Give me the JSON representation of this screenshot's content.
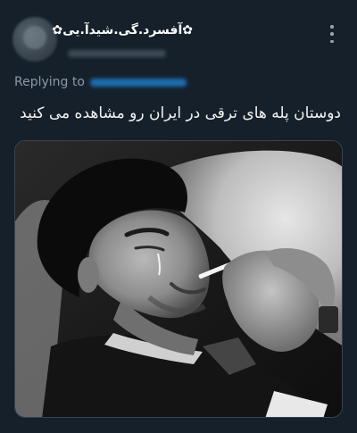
{
  "author": {
    "display_name": "✿آفسرد.گی.شیدآ.یی✿"
  },
  "reply": {
    "label": "Replying to"
  },
  "tweet": {
    "text": "دوستان پله های ترقی در ایران رو مشاهده می کنید"
  },
  "media": {
    "alt": "black and white photo of a man lying on a pillow, smoking with a tear on his cheek"
  },
  "icons": {
    "more": "more-vertical-icon"
  },
  "colors": {
    "background": "#15202b",
    "secondary_text": "#8b98a5",
    "link_blue": "#1d6fb0"
  }
}
